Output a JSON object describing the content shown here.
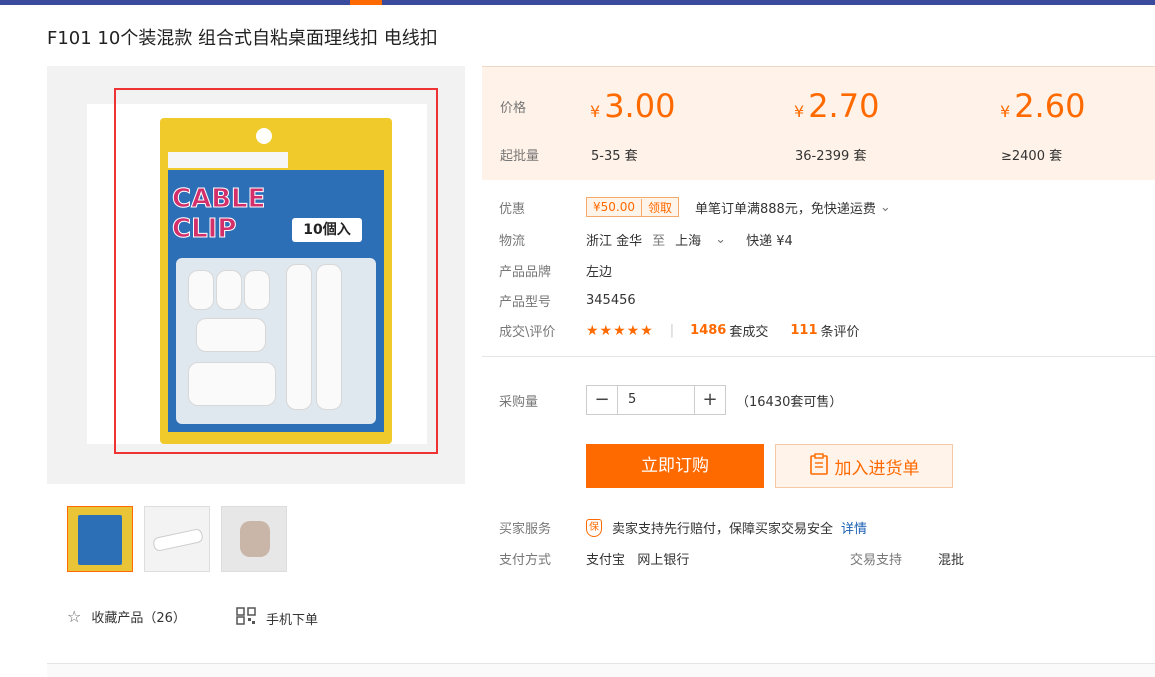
{
  "product": {
    "title": "F101 10个装混款 组合式自粘桌面理线扣 电线扣",
    "image_text": {
      "line1": "CABLE",
      "line2": "CLIP",
      "badge": "10個入"
    }
  },
  "price": {
    "price_label": "价格",
    "batch_label": "起批量",
    "currency": "¥",
    "tiers": [
      {
        "price": "3.00",
        "qty": "5-35 套"
      },
      {
        "price": "2.70",
        "qty": "36-2399 套"
      },
      {
        "price": "2.60",
        "qty": "≥2400 套"
      }
    ]
  },
  "details": {
    "discount_label": "优惠",
    "coupon_value": "¥50.00",
    "coupon_action": "领取",
    "discount_text": "单笔订单满888元，免快递运费",
    "logistics_label": "物流",
    "from": "浙江 金华",
    "to_word": "至",
    "dest": "上海",
    "shipping": "快递 ¥4",
    "brand_label": "产品品牌",
    "brand": "左边",
    "model_label": "产品型号",
    "model": "345456",
    "deals_label": "成交\\评价",
    "stars": "★★★★★",
    "rating": 4.5,
    "deals_count": "1486",
    "deals_unit": "套成交",
    "review_count": "111",
    "review_unit": "条评价"
  },
  "purchase": {
    "qty_label": "采购量",
    "qty_value": "5",
    "stock": "（16430套可售）",
    "buy_label": "立即订购",
    "cart_label": "加入进货单"
  },
  "service": {
    "buyer_label": "买家服务",
    "shield_text": "保",
    "buyer_text": "卖家支持先行赔付，保障买家交易安全",
    "detail_link": "详情",
    "pay_label": "支付方式",
    "pay_methods": "支付宝   网上银行",
    "trade_label": "交易支持",
    "trade_value": "混批"
  },
  "actions": {
    "fav": "收藏产品（26）",
    "mobile": "手机下单"
  },
  "colors": {
    "accent": "#ff6a00",
    "topbar": "#3a4a9c",
    "price_bg": "#fff2e8"
  }
}
